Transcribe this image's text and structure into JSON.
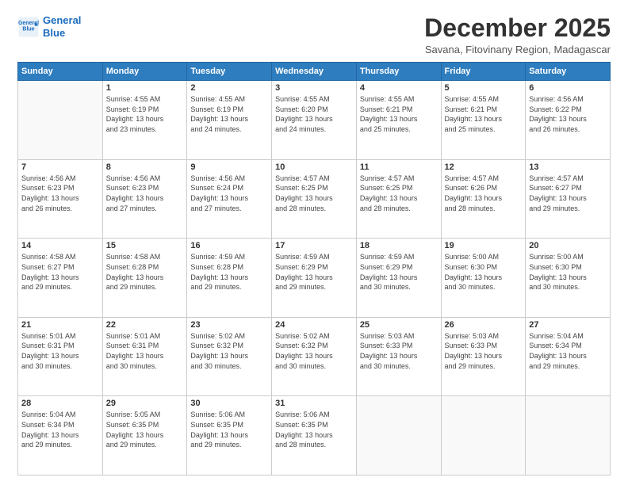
{
  "logo": {
    "line1": "General",
    "line2": "Blue"
  },
  "title": "December 2025",
  "subtitle": "Savana, Fitovinany Region, Madagascar",
  "days_header": [
    "Sunday",
    "Monday",
    "Tuesday",
    "Wednesday",
    "Thursday",
    "Friday",
    "Saturday"
  ],
  "weeks": [
    [
      {
        "num": "",
        "detail": ""
      },
      {
        "num": "1",
        "detail": "Sunrise: 4:55 AM\nSunset: 6:19 PM\nDaylight: 13 hours\nand 23 minutes."
      },
      {
        "num": "2",
        "detail": "Sunrise: 4:55 AM\nSunset: 6:19 PM\nDaylight: 13 hours\nand 24 minutes."
      },
      {
        "num": "3",
        "detail": "Sunrise: 4:55 AM\nSunset: 6:20 PM\nDaylight: 13 hours\nand 24 minutes."
      },
      {
        "num": "4",
        "detail": "Sunrise: 4:55 AM\nSunset: 6:21 PM\nDaylight: 13 hours\nand 25 minutes."
      },
      {
        "num": "5",
        "detail": "Sunrise: 4:55 AM\nSunset: 6:21 PM\nDaylight: 13 hours\nand 25 minutes."
      },
      {
        "num": "6",
        "detail": "Sunrise: 4:56 AM\nSunset: 6:22 PM\nDaylight: 13 hours\nand 26 minutes."
      }
    ],
    [
      {
        "num": "7",
        "detail": "Sunrise: 4:56 AM\nSunset: 6:23 PM\nDaylight: 13 hours\nand 26 minutes."
      },
      {
        "num": "8",
        "detail": "Sunrise: 4:56 AM\nSunset: 6:23 PM\nDaylight: 13 hours\nand 27 minutes."
      },
      {
        "num": "9",
        "detail": "Sunrise: 4:56 AM\nSunset: 6:24 PM\nDaylight: 13 hours\nand 27 minutes."
      },
      {
        "num": "10",
        "detail": "Sunrise: 4:57 AM\nSunset: 6:25 PM\nDaylight: 13 hours\nand 28 minutes."
      },
      {
        "num": "11",
        "detail": "Sunrise: 4:57 AM\nSunset: 6:25 PM\nDaylight: 13 hours\nand 28 minutes."
      },
      {
        "num": "12",
        "detail": "Sunrise: 4:57 AM\nSunset: 6:26 PM\nDaylight: 13 hours\nand 28 minutes."
      },
      {
        "num": "13",
        "detail": "Sunrise: 4:57 AM\nSunset: 6:27 PM\nDaylight: 13 hours\nand 29 minutes."
      }
    ],
    [
      {
        "num": "14",
        "detail": "Sunrise: 4:58 AM\nSunset: 6:27 PM\nDaylight: 13 hours\nand 29 minutes."
      },
      {
        "num": "15",
        "detail": "Sunrise: 4:58 AM\nSunset: 6:28 PM\nDaylight: 13 hours\nand 29 minutes."
      },
      {
        "num": "16",
        "detail": "Sunrise: 4:59 AM\nSunset: 6:28 PM\nDaylight: 13 hours\nand 29 minutes."
      },
      {
        "num": "17",
        "detail": "Sunrise: 4:59 AM\nSunset: 6:29 PM\nDaylight: 13 hours\nand 29 minutes."
      },
      {
        "num": "18",
        "detail": "Sunrise: 4:59 AM\nSunset: 6:29 PM\nDaylight: 13 hours\nand 30 minutes."
      },
      {
        "num": "19",
        "detail": "Sunrise: 5:00 AM\nSunset: 6:30 PM\nDaylight: 13 hours\nand 30 minutes."
      },
      {
        "num": "20",
        "detail": "Sunrise: 5:00 AM\nSunset: 6:30 PM\nDaylight: 13 hours\nand 30 minutes."
      }
    ],
    [
      {
        "num": "21",
        "detail": "Sunrise: 5:01 AM\nSunset: 6:31 PM\nDaylight: 13 hours\nand 30 minutes."
      },
      {
        "num": "22",
        "detail": "Sunrise: 5:01 AM\nSunset: 6:31 PM\nDaylight: 13 hours\nand 30 minutes."
      },
      {
        "num": "23",
        "detail": "Sunrise: 5:02 AM\nSunset: 6:32 PM\nDaylight: 13 hours\nand 30 minutes."
      },
      {
        "num": "24",
        "detail": "Sunrise: 5:02 AM\nSunset: 6:32 PM\nDaylight: 13 hours\nand 30 minutes."
      },
      {
        "num": "25",
        "detail": "Sunrise: 5:03 AM\nSunset: 6:33 PM\nDaylight: 13 hours\nand 30 minutes."
      },
      {
        "num": "26",
        "detail": "Sunrise: 5:03 AM\nSunset: 6:33 PM\nDaylight: 13 hours\nand 29 minutes."
      },
      {
        "num": "27",
        "detail": "Sunrise: 5:04 AM\nSunset: 6:34 PM\nDaylight: 13 hours\nand 29 minutes."
      }
    ],
    [
      {
        "num": "28",
        "detail": "Sunrise: 5:04 AM\nSunset: 6:34 PM\nDaylight: 13 hours\nand 29 minutes."
      },
      {
        "num": "29",
        "detail": "Sunrise: 5:05 AM\nSunset: 6:35 PM\nDaylight: 13 hours\nand 29 minutes."
      },
      {
        "num": "30",
        "detail": "Sunrise: 5:06 AM\nSunset: 6:35 PM\nDaylight: 13 hours\nand 29 minutes."
      },
      {
        "num": "31",
        "detail": "Sunrise: 5:06 AM\nSunset: 6:35 PM\nDaylight: 13 hours\nand 28 minutes."
      },
      {
        "num": "",
        "detail": ""
      },
      {
        "num": "",
        "detail": ""
      },
      {
        "num": "",
        "detail": ""
      }
    ]
  ]
}
